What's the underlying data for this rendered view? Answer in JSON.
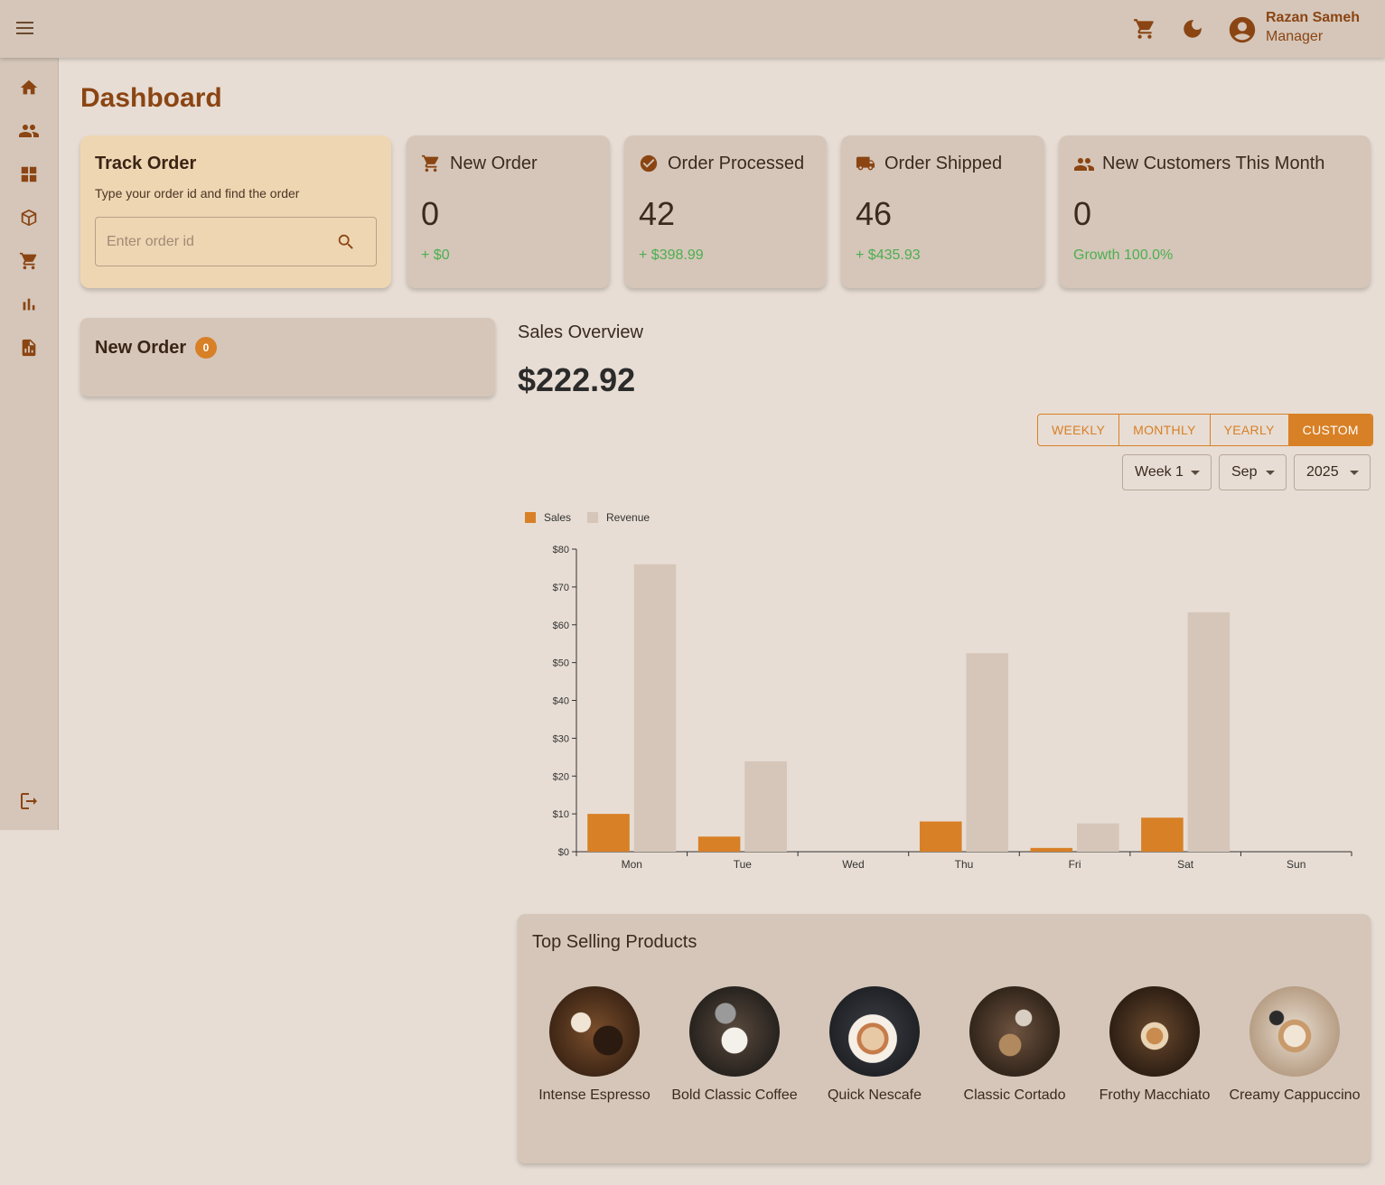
{
  "appbar": {
    "user_name": "Razan Sameh",
    "user_role": "Manager"
  },
  "page": {
    "title": "Dashboard"
  },
  "sidebar": {
    "items": [
      "home-icon",
      "users-icon",
      "dashboard-grid-icon",
      "box-icon",
      "cart-icon",
      "bar-chart-icon",
      "report-icon",
      "logout-icon"
    ]
  },
  "track": {
    "title": "Track Order",
    "subtitle": "Type your order id and find the order",
    "placeholder": "Enter order id"
  },
  "stats": [
    {
      "title": "New Order",
      "value": "0",
      "sub": "+ $0",
      "icon": "cart-icon"
    },
    {
      "title": "Order Processed",
      "value": "42",
      "sub": "+ $398.99",
      "icon": "check-circle-icon"
    },
    {
      "title": "Order Shipped",
      "value": "46",
      "sub": "+ $435.93",
      "icon": "truck-icon"
    },
    {
      "title": "New Customers This Month",
      "value": "0",
      "sub": "Growth 100.0%",
      "icon": "users-icon"
    }
  ],
  "new_order_panel": {
    "title": "New Order",
    "badge": "0"
  },
  "sales": {
    "title": "Sales Overview",
    "total": "$222.92",
    "periods": [
      "WEEKLY",
      "MONTHLY",
      "YEARLY",
      "CUSTOM"
    ],
    "active_period": "CUSTOM",
    "week": "Week 1",
    "month": "Sep",
    "year": "2025"
  },
  "colors": {
    "accent": "#d88026",
    "brand": "#8b4513",
    "revenue": "#d5c6b9",
    "positive": "#4caf50"
  },
  "chart_data": {
    "type": "bar",
    "categories": [
      "Mon",
      "Tue",
      "Wed",
      "Thu",
      "Fri",
      "Sat",
      "Sun"
    ],
    "series": [
      {
        "name": "Sales",
        "values": [
          10,
          4,
          0,
          8,
          1,
          9,
          0
        ],
        "color": "#d88026"
      },
      {
        "name": "Revenue",
        "values": [
          76,
          23.9,
          0,
          52.5,
          7.5,
          63.3,
          0
        ],
        "color": "#d5c6b9"
      }
    ],
    "ylim": [
      0,
      80
    ],
    "yticks": [
      "$0",
      "$10",
      "$20",
      "$30",
      "$40",
      "$50",
      "$60",
      "$70",
      "$80"
    ],
    "legend": "top-left"
  },
  "top_products": {
    "title": "Top Selling Products",
    "items": [
      {
        "name": "Intense Espresso"
      },
      {
        "name": "Bold Classic Coffee"
      },
      {
        "name": "Quick Nescafe"
      },
      {
        "name": "Classic Cortado"
      },
      {
        "name": "Frothy Macchiato"
      },
      {
        "name": "Creamy Cappuccino"
      }
    ]
  }
}
